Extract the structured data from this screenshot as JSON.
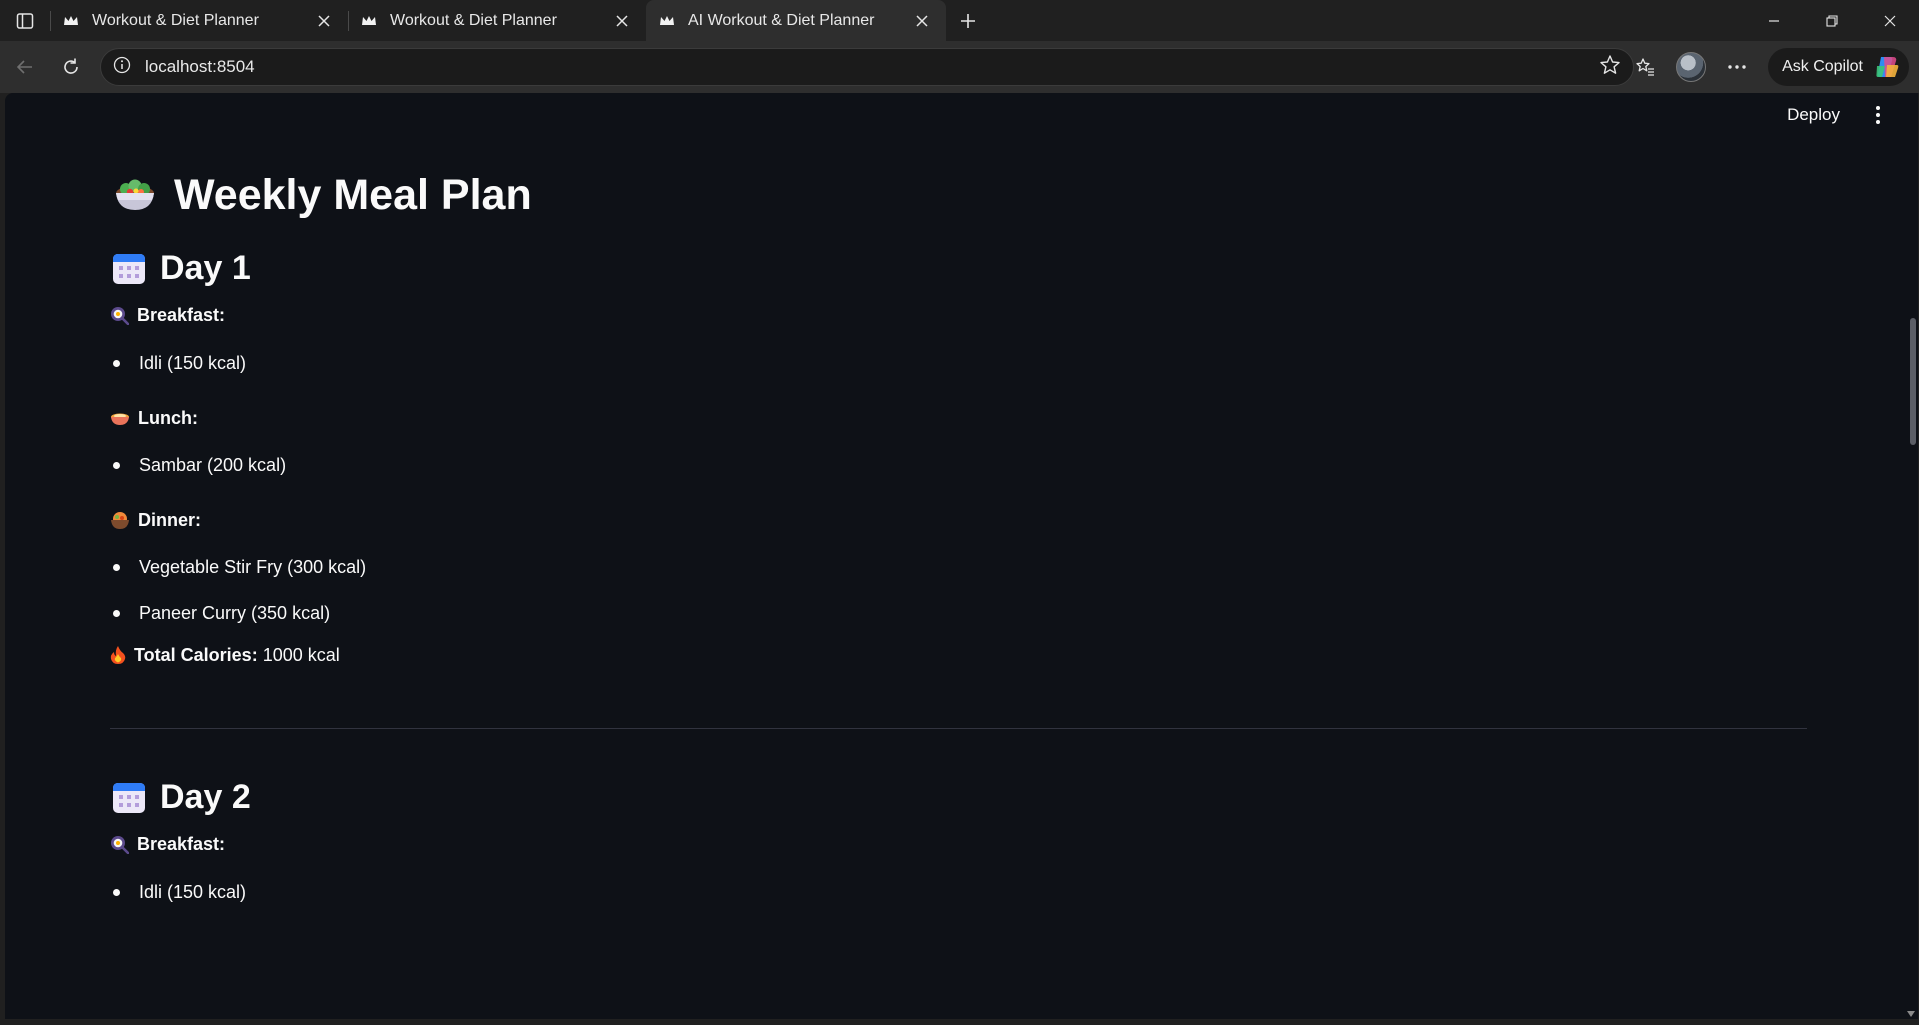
{
  "browser": {
    "tabs": [
      {
        "title": "Workout & Diet Planner",
        "active": false
      },
      {
        "title": "Workout & Diet Planner",
        "active": false
      },
      {
        "title": "AI Workout & Diet Planner",
        "active": true
      }
    ],
    "url": "localhost:8504",
    "copilot_label": "Ask Copilot"
  },
  "app": {
    "deploy_label": "Deploy",
    "page_title": "Weekly Meal Plan",
    "divider_between_days": true
  },
  "days": [
    {
      "title": "Day 1",
      "breakfast_label": "Breakfast:",
      "breakfast_items": [
        "Idli (150 kcal)"
      ],
      "lunch_label": "Lunch:",
      "lunch_items": [
        "Sambar (200 kcal)"
      ],
      "dinner_label": "Dinner:",
      "dinner_items": [
        "Vegetable Stir Fry (300 kcal)",
        "Paneer Curry (350 kcal)"
      ],
      "total_label": "Total Calories:",
      "total_value": "1000 kcal"
    },
    {
      "title": "Day 2",
      "breakfast_label": "Breakfast:",
      "breakfast_items": [
        "Idli (150 kcal)"
      ]
    }
  ],
  "icons": {
    "title": "salad-bowl-icon",
    "day": "calendar-icon",
    "breakfast": "frying-pan-icon",
    "lunch": "curry-bowl-icon",
    "dinner": "stew-pot-icon",
    "total": "fire-icon"
  },
  "colors": {
    "page_background": "#0e1117",
    "text": "#fafafa",
    "divider": "#31333f",
    "browser_frame": "#202020"
  }
}
